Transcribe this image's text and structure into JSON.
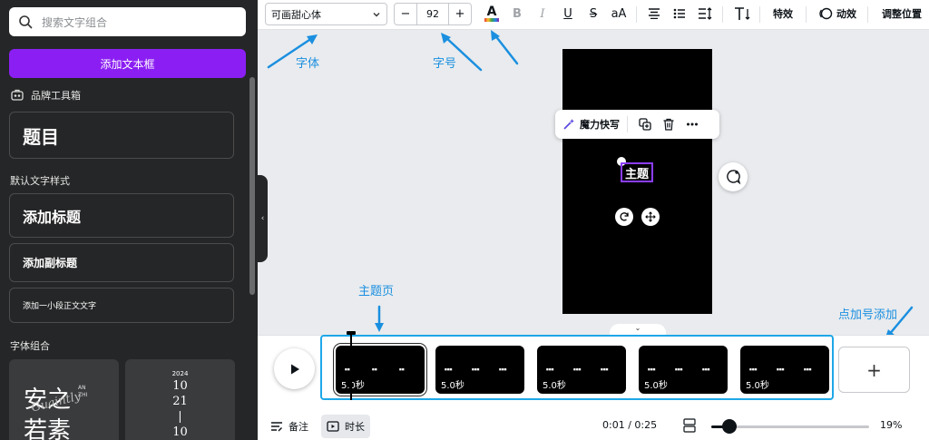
{
  "sidebar": {
    "search_placeholder": "搜索文字组合",
    "add_textbox": "添加文本框",
    "brand_kit": "品牌工具箱",
    "title_card": "题目",
    "default_styles_label": "默认文字样式",
    "heading": "添加标题",
    "subheading": "添加副标题",
    "body_text": "添加一小段正文文字",
    "font_combos_label": "字体组合",
    "thumb1": {
      "line1": "安之",
      "line2": "若素",
      "side": "AN ZHI",
      "script": "Guaintly"
    },
    "thumb2": {
      "year": "2024",
      "l1": "10",
      "l2": "21",
      "l3": "|",
      "l4": "10"
    }
  },
  "toolbar": {
    "font_name": "可画甜心体",
    "font_size": "92",
    "minus": "−",
    "plus": "+",
    "text_color_glyph": "A",
    "bold": "B",
    "italic": "I",
    "underline": "U",
    "strike": "S",
    "case": "aA",
    "effects": "特效",
    "animate": "动效",
    "position": "调整位置",
    "accent_color": "#8b3dff"
  },
  "canvas": {
    "text_element": "主题",
    "context_menu": {
      "magic_write": "魔力快写"
    }
  },
  "annotations": {
    "font": "字体",
    "size": "字号",
    "theme_page": "主题页",
    "add_scene": "点加号添加",
    "color": "#1a8fe0"
  },
  "timeline": {
    "scenes": [
      {
        "duration": "5.0秒",
        "active": true
      },
      {
        "duration": "5.0秒",
        "active": false
      },
      {
        "duration": "5.0秒",
        "active": false
      },
      {
        "duration": "5.0秒",
        "active": false
      },
      {
        "duration": "5.0秒",
        "active": false
      }
    ],
    "add": "+",
    "notes": "备注",
    "duration_btn": "时长",
    "time": "0:01 / 0:25",
    "zoom": "19%",
    "zoom_fraction": 0.19
  }
}
